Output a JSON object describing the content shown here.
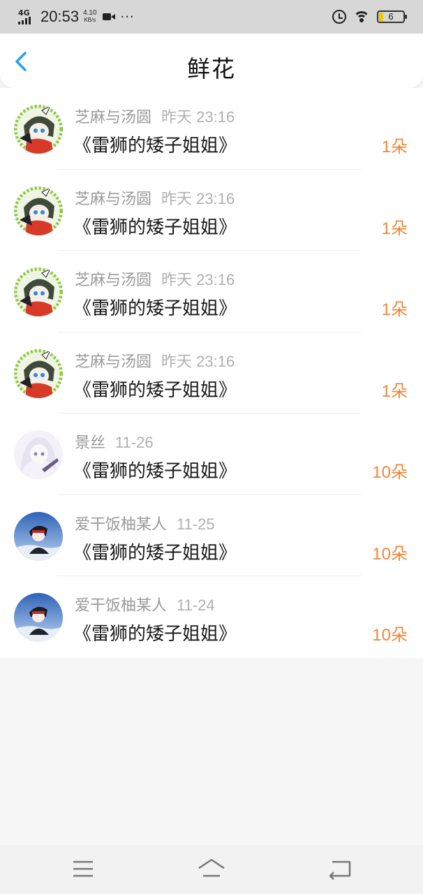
{
  "status_bar": {
    "network": "4G",
    "time": "20:53",
    "speed_value": "4.10",
    "speed_unit": "KB/s",
    "dots": "···",
    "battery_level": "6"
  },
  "header": {
    "title": "鲜花",
    "back_icon": "chevron-left-icon",
    "accent_color": "#2b9cf0"
  },
  "items": [
    {
      "name": "芝麻与汤圆",
      "time": "昨天 23:16",
      "book": "《雷狮的矮子姐姐》",
      "count": "1朵",
      "avatar": "green-hair-character"
    },
    {
      "name": "芝麻与汤圆",
      "time": "昨天 23:16",
      "book": "《雷狮的矮子姐姐》",
      "count": "1朵",
      "avatar": "green-hair-character"
    },
    {
      "name": "芝麻与汤圆",
      "time": "昨天 23:16",
      "book": "《雷狮的矮子姐姐》",
      "count": "1朵",
      "avatar": "green-hair-character"
    },
    {
      "name": "芝麻与汤圆",
      "time": "昨天 23:16",
      "book": "《雷狮的矮子姐姐》",
      "count": "1朵",
      "avatar": "green-hair-character"
    },
    {
      "name": "景丝",
      "time": "11-26",
      "book": "《雷狮的矮子姐姐》",
      "count": "10朵",
      "avatar": "white-hair-character"
    },
    {
      "name": "爱干饭柚某人",
      "time": "11-25",
      "book": "《雷狮的矮子姐姐》",
      "count": "10朵",
      "avatar": "blue-sky-character"
    },
    {
      "name": "爱干饭柚某人",
      "time": "11-24",
      "book": "《雷狮的矮子姐姐》",
      "count": "10朵",
      "avatar": "blue-sky-character"
    }
  ],
  "count_color": "#f1873a",
  "nav_bar": {
    "menu_icon": "menu-icon",
    "home_icon": "home-icon",
    "back_icon": "back-arrow-icon"
  }
}
